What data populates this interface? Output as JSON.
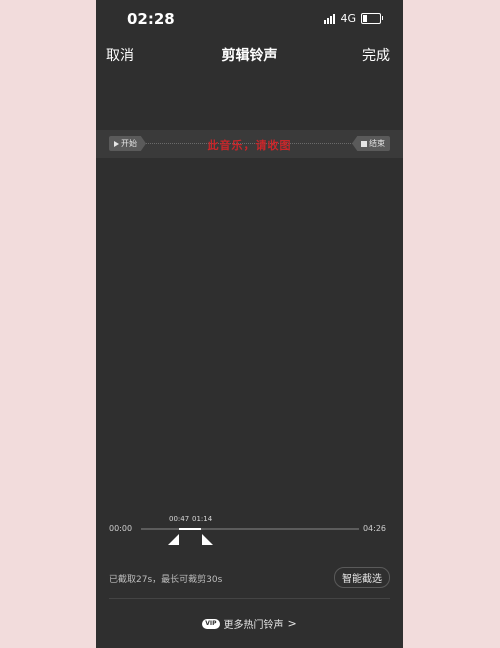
{
  "status": {
    "time": "02:28",
    "network": "4G"
  },
  "nav": {
    "cancel": "取消",
    "title": "剪辑铃声",
    "done": "完成"
  },
  "player": {
    "start_label": "开始",
    "end_label": "结束",
    "hint": "此音乐，请收图"
  },
  "timeline": {
    "start": "00:00",
    "end": "04:26",
    "sel_start": "00:47",
    "sel_end": "01:14"
  },
  "info": {
    "text": "已截取27s，最长可裁剪30s",
    "smart_button": "智能截选"
  },
  "footer": {
    "vip_badge": "VIP",
    "label": "更多热门铃声",
    "chevron": ">"
  }
}
